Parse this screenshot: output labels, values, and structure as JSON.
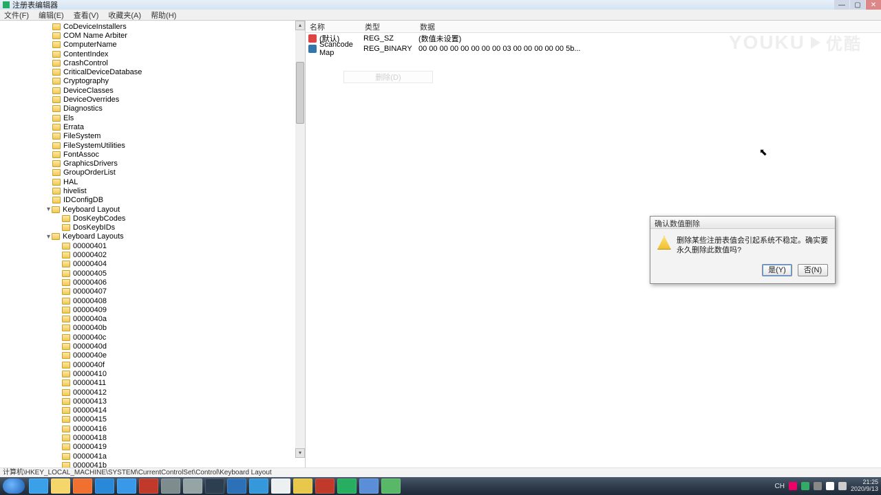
{
  "title": "注册表编辑器",
  "menubar": [
    "文件(F)",
    "编辑(E)",
    "查看(V)",
    "收藏夹(A)",
    "帮助(H)"
  ],
  "tree": {
    "indent_base": 76,
    "items": [
      {
        "label": "CoDeviceInstallers",
        "depth": 0
      },
      {
        "label": "COM Name Arbiter",
        "depth": 0
      },
      {
        "label": "ComputerName",
        "depth": 0
      },
      {
        "label": "ContentIndex",
        "depth": 0
      },
      {
        "label": "CrashControl",
        "depth": 0
      },
      {
        "label": "CriticalDeviceDatabase",
        "depth": 0
      },
      {
        "label": "Cryptography",
        "depth": 0
      },
      {
        "label": "DeviceClasses",
        "depth": 0
      },
      {
        "label": "DeviceOverrides",
        "depth": 0
      },
      {
        "label": "Diagnostics",
        "depth": 0
      },
      {
        "label": "Els",
        "depth": 0
      },
      {
        "label": "Errata",
        "depth": 0
      },
      {
        "label": "FileSystem",
        "depth": 0
      },
      {
        "label": "FileSystemUtilities",
        "depth": 0
      },
      {
        "label": "FontAssoc",
        "depth": 0
      },
      {
        "label": "GraphicsDrivers",
        "depth": 0
      },
      {
        "label": "GroupOrderList",
        "depth": 0
      },
      {
        "label": "HAL",
        "depth": 0
      },
      {
        "label": "hivelist",
        "depth": 0
      },
      {
        "label": "IDConfigDB",
        "depth": 0
      },
      {
        "label": "Keyboard Layout",
        "depth": 0,
        "expanded": true
      },
      {
        "label": "DosKeybCodes",
        "depth": 1
      },
      {
        "label": "DosKeybIDs",
        "depth": 1
      },
      {
        "label": "Keyboard Layouts",
        "depth": 0,
        "expanded": true
      },
      {
        "label": "00000401",
        "depth": 1
      },
      {
        "label": "00000402",
        "depth": 1
      },
      {
        "label": "00000404",
        "depth": 1
      },
      {
        "label": "00000405",
        "depth": 1
      },
      {
        "label": "00000406",
        "depth": 1
      },
      {
        "label": "00000407",
        "depth": 1
      },
      {
        "label": "00000408",
        "depth": 1
      },
      {
        "label": "00000409",
        "depth": 1
      },
      {
        "label": "0000040a",
        "depth": 1
      },
      {
        "label": "0000040b",
        "depth": 1
      },
      {
        "label": "0000040c",
        "depth": 1
      },
      {
        "label": "0000040d",
        "depth": 1
      },
      {
        "label": "0000040e",
        "depth": 1
      },
      {
        "label": "0000040f",
        "depth": 1
      },
      {
        "label": "00000410",
        "depth": 1
      },
      {
        "label": "00000411",
        "depth": 1
      },
      {
        "label": "00000412",
        "depth": 1
      },
      {
        "label": "00000413",
        "depth": 1
      },
      {
        "label": "00000414",
        "depth": 1
      },
      {
        "label": "00000415",
        "depth": 1
      },
      {
        "label": "00000416",
        "depth": 1
      },
      {
        "label": "00000418",
        "depth": 1
      },
      {
        "label": "00000419",
        "depth": 1
      },
      {
        "label": "0000041a",
        "depth": 1
      },
      {
        "label": "0000041b",
        "depth": 1
      }
    ]
  },
  "right": {
    "headers": {
      "name": "名称",
      "type": "类型",
      "data": "数据"
    },
    "rows": [
      {
        "icon": "sz",
        "name": "(默认)",
        "type": "REG_SZ",
        "data": "(数值未设置)"
      },
      {
        "icon": "bin",
        "name": "Scancode Map",
        "type": "REG_BINARY",
        "data": "00 00 00 00 00 00 00 00 03 00 00 00 00 00 5b..."
      }
    ],
    "context_ghost": "删除(D)"
  },
  "watermark": {
    "brand": "YOUKU",
    "cn": "优酷"
  },
  "dialog": {
    "title": "确认数值删除",
    "message": "删除某些注册表值会引起系统不稳定。确实要永久删除此数值吗?",
    "yes": "是(Y)",
    "no": "否(N)"
  },
  "statusbar": "计算机\\HKEY_LOCAL_MACHINE\\SYSTEM\\CurrentControlSet\\Control\\Keyboard Layout",
  "taskbar_icons": [
    {
      "name": "ie",
      "color": "#3aa0e8"
    },
    {
      "name": "explorer",
      "color": "#f5d66b"
    },
    {
      "name": "wmp",
      "color": "#f07030"
    },
    {
      "name": "app1",
      "color": "#2a88d8"
    },
    {
      "name": "app2",
      "color": "#3a98e8"
    },
    {
      "name": "app3",
      "color": "#c0392b"
    },
    {
      "name": "app4",
      "color": "#7f8c8d"
    },
    {
      "name": "app5",
      "color": "#95a5a6"
    },
    {
      "name": "app6",
      "color": "#2c3e50"
    },
    {
      "name": "app7",
      "color": "#2c70b8"
    },
    {
      "name": "app8",
      "color": "#3498db"
    },
    {
      "name": "app9",
      "color": "#ecf0f1"
    },
    {
      "name": "chrome",
      "color": "#e8c84a"
    },
    {
      "name": "app10",
      "color": "#c0392b"
    },
    {
      "name": "app11",
      "color": "#27ae60"
    },
    {
      "name": "app12",
      "color": "#5a8fd8"
    },
    {
      "name": "regedit",
      "color": "#58b868"
    }
  ],
  "tray": {
    "time": "21:25",
    "date": "2020/9/13",
    "lang": "CH"
  }
}
